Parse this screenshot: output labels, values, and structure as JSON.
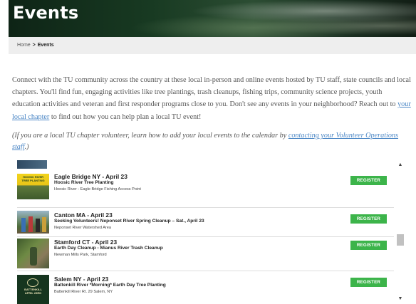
{
  "header": {
    "title": "Events"
  },
  "breadcrumb": {
    "home": "Home",
    "separator": ">",
    "current": "Events"
  },
  "intro": {
    "text_before_link": "Connect with the TU community across the country at these local in-person and online events hosted by TU staff, state councils and local chapters. You'll find fun, engaging activities like tree plantings, trash cleanups, fishing trips, community science projects, youth education activities and veteran and first responder programs close to you. Don't see any events in your neighborhood? Reach out to ",
    "link_text": "your local chapter",
    "text_after_link": " to find out how you can help plan a local TU event!"
  },
  "note": {
    "text_before_link": "(If you are a local TU chapter volunteer, learn how to add your local events to the calendar by ",
    "link_text": "contacting your Volunteer Operations staff",
    "text_after_link": ".)"
  },
  "events": [
    {
      "title": "Eagle Bridge NY - April 23",
      "subtitle": "Hoosic River Tree Planting",
      "location": "Hoosic River - Eagle Bridge Fishing Access Point",
      "button": "REGISTER",
      "thumb_label_1": "HOOSIC RIVER",
      "thumb_label_2": "TREE PLANTING"
    },
    {
      "title": "Canton MA - April 23",
      "subtitle": "Seeking Volunteers! Neponset River Spring Cleanup – Sat., April 23",
      "location": "Neponset River Watershed Area",
      "button": "REGISTER"
    },
    {
      "title": "Stamford CT - April 23",
      "subtitle": "Earth Day Cleanup - Mianus River Trash Cleanup",
      "location": "Newman Mills Park, Stamford",
      "button": "REGISTER"
    },
    {
      "title": "Salem NY - April 23",
      "subtitle": "Battenkill River *Morning* Earth Day Tree Planting",
      "location": "Battenkill River Rt. 29 Salem, NY",
      "button": "REGISTER",
      "thumb_label_1": "BATTENKILL",
      "thumb_label_2": "APRIL",
      "thumb_label_3": "23RD"
    }
  ],
  "scrollbar": {
    "up_icon": "▲",
    "down_icon": "▼"
  },
  "colors": {
    "register_green": "#3cb44a",
    "link_blue": "#4a86c5"
  }
}
